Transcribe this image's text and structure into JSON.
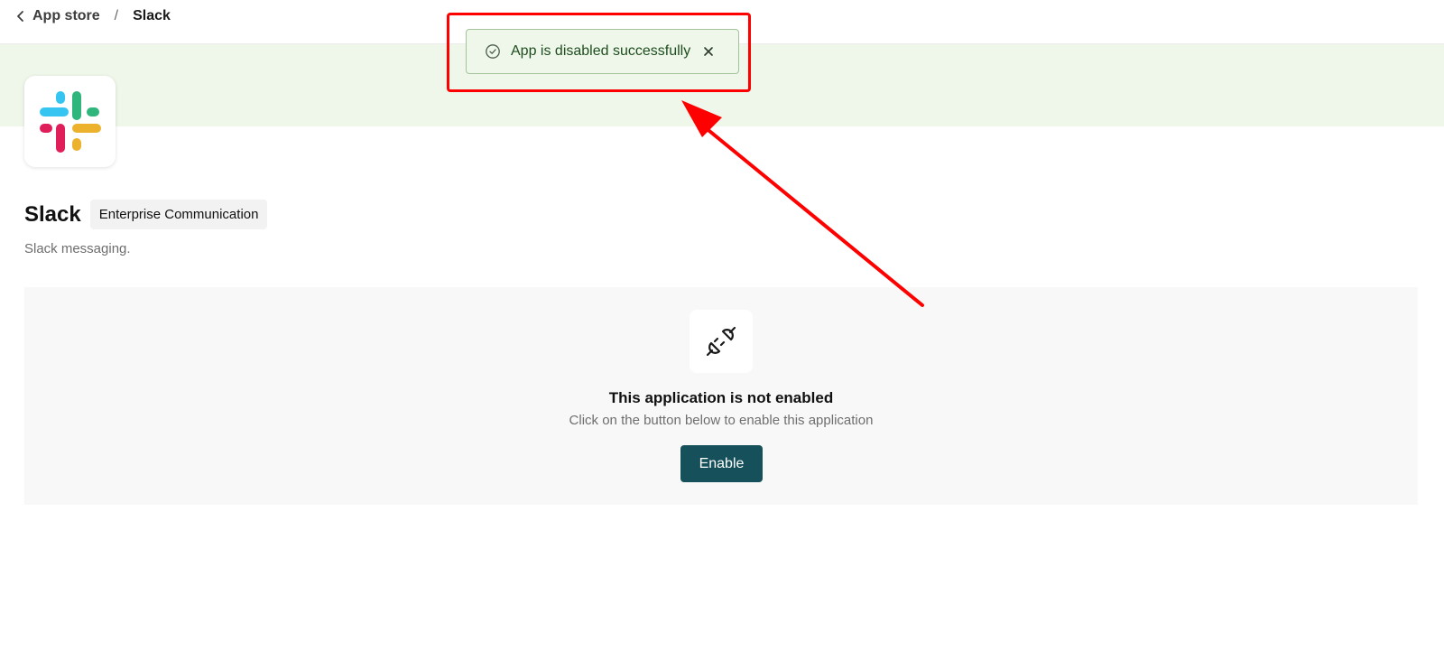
{
  "breadcrumb": {
    "back_label": "App store",
    "separator": "/",
    "current": "Slack"
  },
  "app": {
    "name": "Slack",
    "category": "Enterprise Communication",
    "description": "Slack messaging.",
    "logo_icon": "slack-logo-icon"
  },
  "empty_state": {
    "icon": "unplugged-icon",
    "title": "This application is not enabled",
    "subtitle": "Click on the button below to enable this application",
    "button_label": "Enable"
  },
  "toast": {
    "icon": "check-circle-icon",
    "message": "App is disabled successfully",
    "close_icon": "close-icon"
  },
  "colors": {
    "banner": "#eff6ea",
    "primary_button": "#16505a",
    "toast_bg": "#eef7e9",
    "toast_text": "#1f4d1f",
    "annotation": "#ff0000"
  }
}
